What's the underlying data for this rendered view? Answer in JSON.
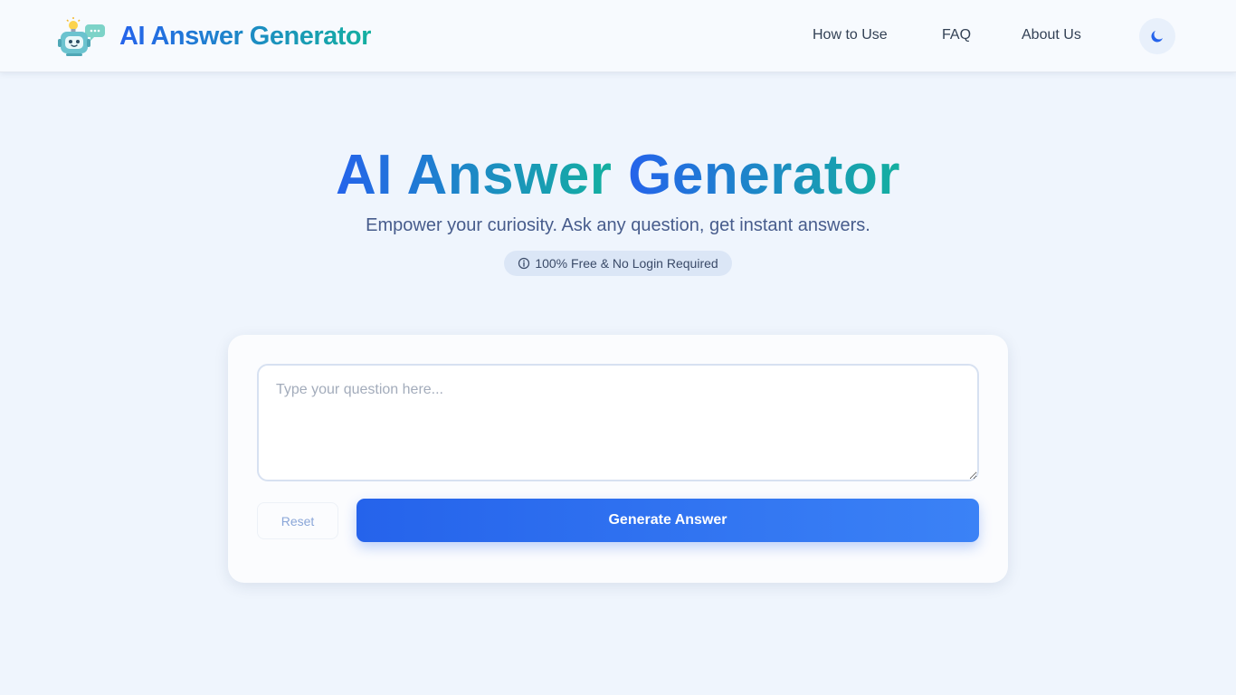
{
  "header": {
    "logo_text": "AI Answer Generator",
    "nav": [
      {
        "label": "How to Use"
      },
      {
        "label": "FAQ"
      },
      {
        "label": "About Us"
      }
    ],
    "theme_toggle_icon": "moon-icon"
  },
  "hero": {
    "title_part1": "AI Answer",
    "title_part2": "Generator",
    "subtitle": "Empower your curiosity. Ask any question, get instant answers.",
    "badge": "100% Free & No Login Required",
    "badge_icon": "info-icon"
  },
  "form": {
    "question_placeholder": "Type your question here...",
    "question_value": "",
    "reset_label": "Reset",
    "generate_label": "Generate Answer"
  },
  "colors": {
    "page_background": "#eff5fd",
    "brand_blue": "#2563eb",
    "brand_teal": "#14b0a0",
    "button_gradient_end": "#3b82f6"
  }
}
